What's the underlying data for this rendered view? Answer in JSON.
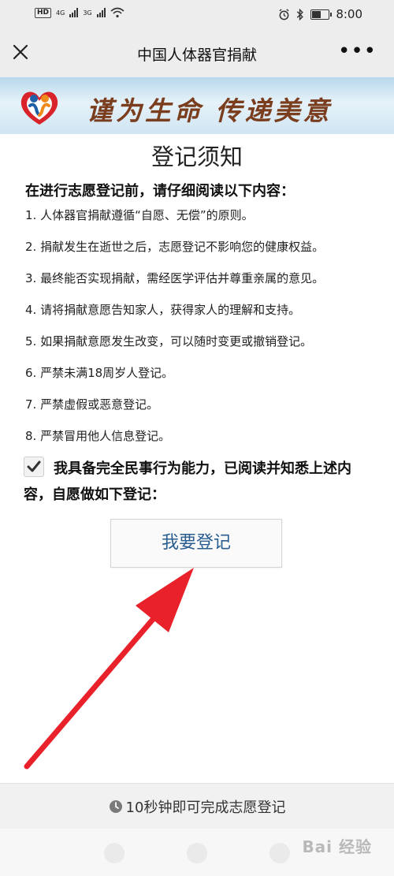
{
  "status_bar": {
    "left_badge": "HD",
    "network_1": "4G",
    "network_2": "3G",
    "time": "8:00",
    "battery_level": 0.6
  },
  "nav": {
    "title": "中国人体器官捐献",
    "more_label": "•••"
  },
  "banner": {
    "slogan": "谨为生命  传递美意"
  },
  "content": {
    "title": "登记须知",
    "intro": "在进行志愿登记前，请仔细阅读以下内容：",
    "rules": [
      "1. 人体器官捐献遵循“自愿、无偿”的原则。",
      "2. 捐献发生在逝世之后，志愿登记不影响您的健康权益。",
      "3. 最终能否实现捐献，需经医学评估并尊重亲属的意见。",
      "4. 请将捐献意愿告知家人，获得家人的理解和支持。",
      "5. 如果捐献意愿发生改变，可以随时变更或撤销登记。",
      "6. 严禁未满18周岁人登记。",
      "7. 严禁虚假或恶意登记。",
      "8. 严禁冒用他人信息登记。"
    ],
    "consent_checked": true,
    "consent_text": "我具备完全民事行为能力，已阅读并知悉上述内容，自愿做如下登记：",
    "register_button": "我要登记"
  },
  "footer": {
    "note": "10秒钟即可完成志愿登记",
    "watermark": "Bai 经验"
  },
  "colors": {
    "accent_text": "#2a5d8f",
    "arrow": "#e8212a",
    "slogan": "#7a3d1e"
  },
  "icons": [
    "close-icon",
    "more-icon",
    "organ-donation-logo",
    "checkmark-icon",
    "clock-icon",
    "arrow-pointer"
  ]
}
